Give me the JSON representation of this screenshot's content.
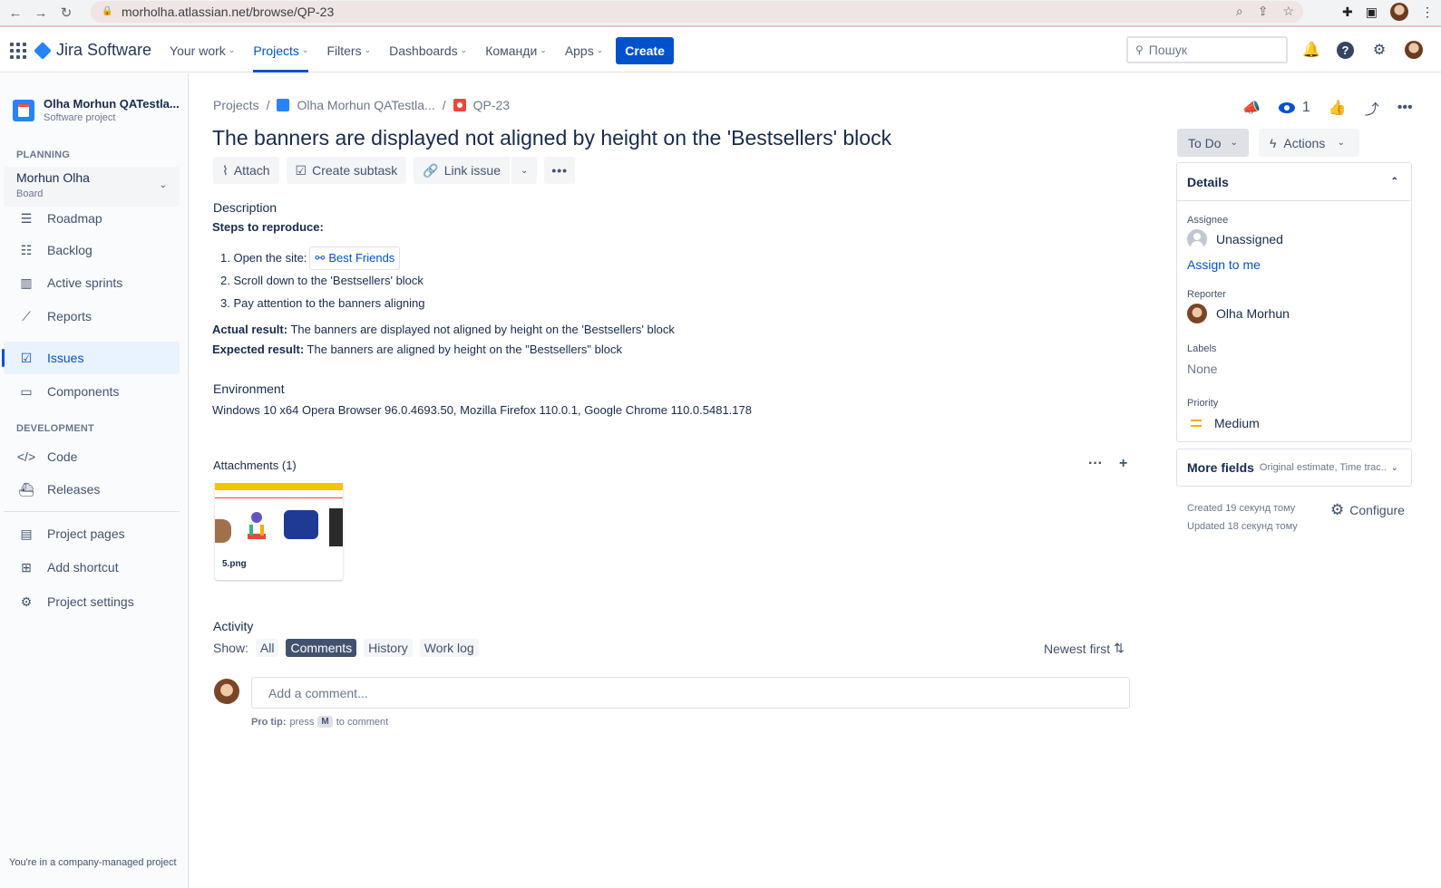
{
  "browser": {
    "url": "morholha.atlassian.net/browse/QP-23"
  },
  "topnav": {
    "logo_text": "Jira Software",
    "items": [
      {
        "label": "Your work"
      },
      {
        "label": "Projects"
      },
      {
        "label": "Filters"
      },
      {
        "label": "Dashboards"
      },
      {
        "label": "Команди"
      },
      {
        "label": "Apps"
      }
    ],
    "create_label": "Create",
    "search_placeholder": "Пошук"
  },
  "sidebar": {
    "project_name": "Olha Morhun QATestla...",
    "project_type": "Software project",
    "planning_label": "PLANNING",
    "board_name": "Morhun Olha",
    "board_type": "Board",
    "planning_items": [
      {
        "label": "Roadmap",
        "icon": "roadmap-icon"
      },
      {
        "label": "Backlog",
        "icon": "backlog-icon"
      },
      {
        "label": "Active sprints",
        "icon": "board-icon"
      },
      {
        "label": "Reports",
        "icon": "chart-icon"
      }
    ],
    "issues_label": "Issues",
    "components_label": "Components",
    "development_label": "DEVELOPMENT",
    "dev_items": [
      {
        "label": "Code"
      },
      {
        "label": "Releases"
      }
    ],
    "bottom_items": [
      {
        "label": "Project pages"
      },
      {
        "label": "Add shortcut"
      },
      {
        "label": "Project settings"
      }
    ],
    "footer": "You're in a company-managed project"
  },
  "breadcrumb": {
    "projects": "Projects",
    "project": "Olha Morhun QATestla...",
    "issue_key": "QP-23"
  },
  "issue": {
    "title": "The banners are displayed not aligned by height on the 'Bestsellers' block",
    "actions": {
      "attach": "Attach",
      "create_subtask": "Create subtask",
      "link_issue": "Link issue"
    },
    "description_label": "Description",
    "steps_heading": "Steps to reproduce:",
    "steps": [
      {
        "num": "1.",
        "text": "Open the site:",
        "link": "Best Friends"
      },
      {
        "num": "2.",
        "text": "Scroll down to the 'Bestsellers' block"
      },
      {
        "num": "3.",
        "text": "Pay attention to the banners aligning"
      }
    ],
    "actual_label": "Actual result:",
    "actual_text": "The banners are displayed not aligned by height on the 'Bestsellers' block",
    "expected_label": "Expected result:",
    "expected_text": "The banners are aligned by height on the \"Bestsellers\" block",
    "environment_label": "Environment",
    "environment_text": "Windows 10 x64 Opera Browser 96.0.4693.50, Mozilla Firefox 110.0.1, Google Chrome 110.0.5481.178",
    "attachments_label": "Attachments (1)",
    "attachment_name": "5.png"
  },
  "activity": {
    "label": "Activity",
    "show_label": "Show:",
    "tabs": [
      {
        "label": "All"
      },
      {
        "label": "Comments"
      },
      {
        "label": "History"
      },
      {
        "label": "Work log"
      }
    ],
    "active_tab": "Comments",
    "sort_label": "Newest first",
    "comment_placeholder": "Add a comment...",
    "pro_tip_bold": "Pro tip:",
    "pro_tip_press": "press",
    "pro_tip_key": "M",
    "pro_tip_rest": "to comment"
  },
  "right_panel": {
    "watchers_count": "1",
    "status": "To Do",
    "actions_label": "Actions",
    "details_label": "Details",
    "assignee_label": "Assignee",
    "assignee_value": "Unassigned",
    "assign_to_me": "Assign to me",
    "reporter_label": "Reporter",
    "reporter_value": "Olha Morhun",
    "labels_label": "Labels",
    "labels_value": "None",
    "priority_label": "Priority",
    "priority_value": "Medium",
    "more_fields_label": "More fields",
    "more_fields_sub": "Original estimate, Time trac...",
    "created": "Created 19 секунд тому",
    "updated": "Updated 18 секунд тому",
    "configure_label": "Configure"
  },
  "colors": {
    "brand_blue": "#0052cc",
    "priority_medium": "#ffab00",
    "bug_red": "#e5493a"
  }
}
